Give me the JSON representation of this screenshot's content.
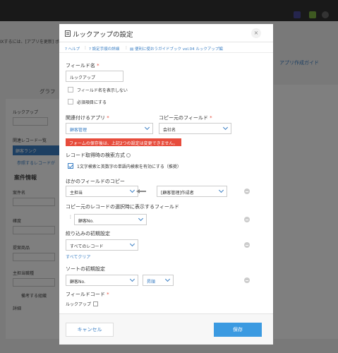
{
  "background": {
    "notice": "Ⅸするには、[アプリを更新] ボタン",
    "tab_label": "グラフ",
    "form_lookup_label": "ルックアップ",
    "form_related_label": "関連レコード一覧",
    "form_related_sel": "顧客ランク",
    "form_related_link": "参照するレコードが",
    "form_section_title": "案件情報",
    "form_field_1": "案件名",
    "form_field_2": "確度",
    "form_field_3": "提案商品",
    "form_field_4": "主担当職種",
    "form_field_5": "備考する組織",
    "form_field_6": "詳細",
    "right_link": "アプリ作成ガイド"
  },
  "dialog": {
    "title": "ルックアップの設定",
    "close_glyph": "×",
    "help_links": [
      "ヘルプ",
      "設定手順の詳細",
      "便利に使おうガイドブック vol.04 ルックアップ編"
    ],
    "field_name_label": "フィールド名",
    "required_mark": "*",
    "field_name_value": "ルックアップ",
    "hide_field_name_label": "フィールド名を表示しない",
    "required_field_label": "必須項目にする",
    "related_app_label": "関連付けるアプリ",
    "related_app_value": "顧客管理",
    "copy_source_label": "コピー元のフィールド",
    "copy_source_value": "会社名",
    "error_text": "フォームの保存後は、上記2つの設定は変更できません。",
    "search_method_label": "レコード取得時の検索方式",
    "search_method_option": "1文字検索と英数字の単語内検索を有効にする（推奨）",
    "other_copy_label": "ほかのフィールドのコピー",
    "other_copy_to": "主担当",
    "other_copy_from": "[顧客管理]作成者",
    "display_fields_label": "コピー元のレコードの選択時に表示するフィールド",
    "display_field_value": "顧客No.",
    "filter_label": "絞り込みの初期設定",
    "filter_value": "すべてのレコード",
    "clear_link": "すべてクリア",
    "sort_label": "ソートの初期設定",
    "sort_field": "顧客No.",
    "sort_order": "昇順",
    "field_code_label": "フィールドコード",
    "field_code_value": "ルックアップ",
    "cancel_label": "キャンセル",
    "save_label": "保存"
  },
  "colors": {
    "accent": "#3b7fc4",
    "save_button": "#3b9ae1",
    "error": "#e74c3c",
    "topbar": "#333333"
  }
}
